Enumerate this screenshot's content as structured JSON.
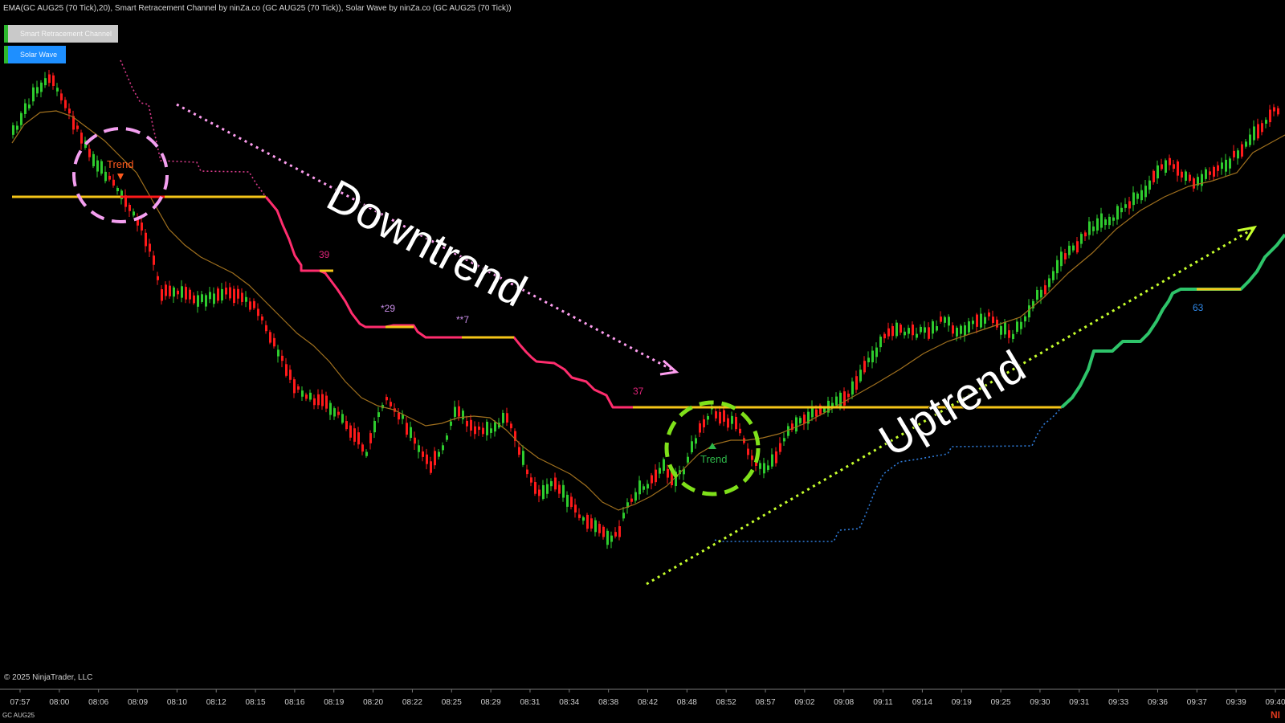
{
  "header": {
    "indicators": "EMA(GC AUG25 (70 Tick),20), Smart Retracement Channel by ninZa.co (GC AUG25 (70 Tick)), Solar Wave by ninZa.co (GC AUG25 (70 Tick))"
  },
  "buttons": {
    "smart_retracement": "Smart Retracement Channel",
    "solar_wave": "Solar Wave"
  },
  "footer": {
    "copyright": "© 2025 NinjaTrader, LLC",
    "instrument": "GC AUG25",
    "brand": "NI"
  },
  "chart_data": {
    "type": "candlestick",
    "x_tick_labels": [
      "07:57",
      "08:00",
      "08:06",
      "08:09",
      "08:10",
      "08:12",
      "08:15",
      "08:16",
      "08:19",
      "08:20",
      "08:22",
      "08:25",
      "08:29",
      "08:31",
      "08:34",
      "08:38",
      "08:42",
      "08:48",
      "08:52",
      "08:57",
      "09:02",
      "09:08",
      "09:11",
      "09:14",
      "09:19",
      "09:25",
      "09:30",
      "09:31",
      "09:33",
      "09:36",
      "09:37",
      "09:39",
      "09:40"
    ],
    "annotations": {
      "downtrend": "Downtrend",
      "uptrend": "Uptrend",
      "trend_sell": "Trend",
      "trend_buy": "Trend"
    },
    "wave_counts": [
      "39",
      "*29",
      "**7",
      "37",
      "63"
    ],
    "colors": {
      "up_candle": "#2ecc2e",
      "down_candle": "#ff1a1a",
      "ema": "#a0701e",
      "channel_line": "#f5c518",
      "bear_wave": "#ff2d6e",
      "bull_wave": "#2ec46a",
      "bear_dots": "#d83a8a",
      "bull_dots": "#2f7bd8",
      "downtrend_arrow": "#ff9ef0",
      "uptrend_arrow": "#c6ff2c",
      "sell_circle": "#f49ff0",
      "buy_circle": "#7fe01a",
      "sell_marker": "#ff5a1e",
      "buy_marker": "#2fb84a"
    }
  }
}
